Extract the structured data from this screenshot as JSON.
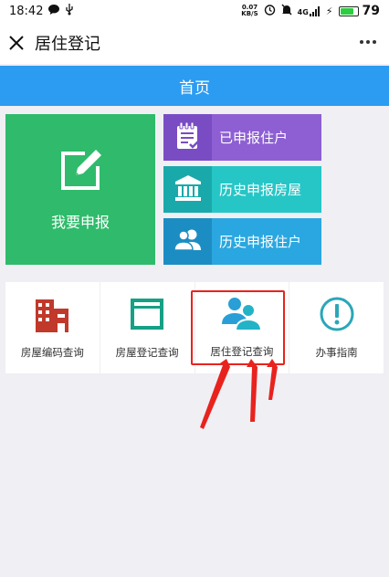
{
  "status": {
    "time": "18:42",
    "net_speed_top": "0.07",
    "net_speed_bottom": "KB/S",
    "signal": "4G",
    "battery": "79"
  },
  "title_bar": {
    "title": "居住登记"
  },
  "header": {
    "title": "首页"
  },
  "tiles": {
    "big": {
      "label": "我要申报"
    },
    "side": [
      {
        "label": "已申报住户"
      },
      {
        "label": "历史申报房屋"
      },
      {
        "label": "历史申报住户"
      }
    ]
  },
  "grid": [
    {
      "label": "房屋编码查询",
      "icon": "building-icon",
      "color": "#c0392b"
    },
    {
      "label": "房屋登记查询",
      "icon": "window-icon",
      "color": "#16a085"
    },
    {
      "label": "居住登记查询",
      "icon": "users-icon",
      "color": "#2a9fd6"
    },
    {
      "label": "办事指南",
      "icon": "info-icon",
      "color": "#2aa7b8"
    }
  ]
}
